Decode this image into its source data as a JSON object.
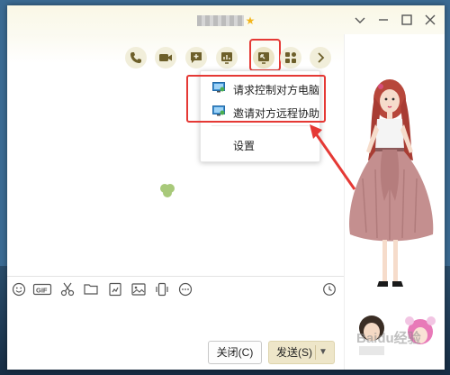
{
  "window": {
    "title_suffix_icon": "star-icon",
    "controls": [
      "chevron-down-icon",
      "minimize-icon",
      "maximize-icon",
      "close-icon"
    ]
  },
  "toolbar": {
    "buttons": [
      "phone-icon",
      "video-call-icon",
      "add-chat-icon",
      "screen-share-icon",
      "remote-assist-icon",
      "apps-icon",
      "more-arrow-icon"
    ]
  },
  "dropdown_menu": {
    "items": [
      {
        "label": "请求控制对方电脑",
        "icon": "monitor-control-icon"
      },
      {
        "label": "邀请对方远程协助",
        "icon": "monitor-assist-icon"
      },
      {
        "label": "设置",
        "icon": ""
      }
    ]
  },
  "input_toolbar": {
    "icons": [
      "emoji-icon",
      "gif-icon",
      "scissors-icon",
      "folder-icon",
      "image-edit-icon",
      "picture-icon",
      "shake-icon",
      "more-icon",
      "history-clock-icon"
    ]
  },
  "buttons": {
    "close_label": "关闭(C)",
    "send_label": "发送(S)"
  },
  "watermark": "Baidu经验",
  "colors": {
    "accent_red": "#e53935",
    "titlebar": "#faf8e6",
    "toolbar_icon": "#6d5f2a"
  }
}
